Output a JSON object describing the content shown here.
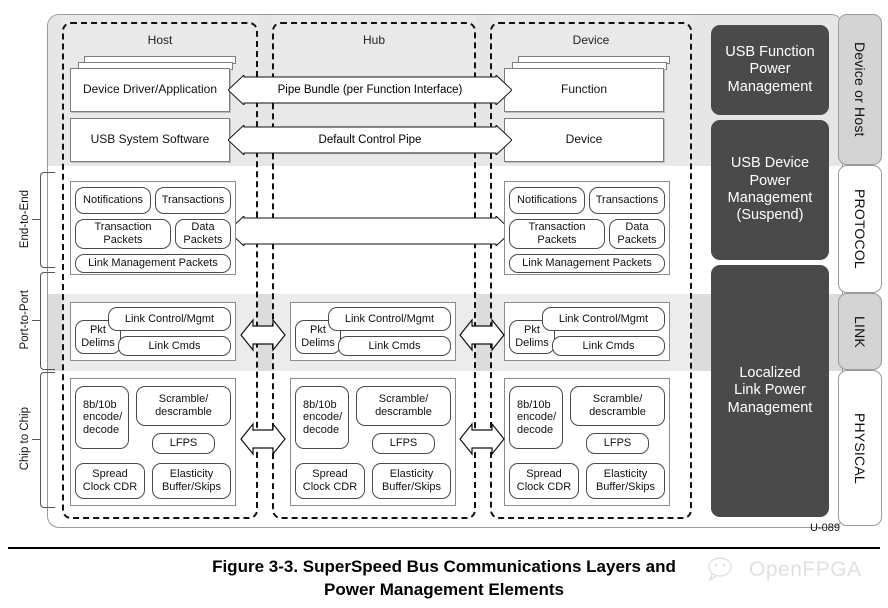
{
  "figure": {
    "caption_line1": "Figure 3-3.  SuperSpeed Bus Communications Layers and",
    "caption_line2": "Power Management Elements",
    "code": "U-089",
    "watermark": "OpenFPGA"
  },
  "columns": [
    {
      "id": "host",
      "title": "Host"
    },
    {
      "id": "hub",
      "title": "Hub"
    },
    {
      "id": "device",
      "title": "Device"
    }
  ],
  "layer_tabs": [
    {
      "id": "device-or-host",
      "label": "Device or Host",
      "fill": "#d4d4d4"
    },
    {
      "id": "protocol",
      "label": "PROTOCOL",
      "fill": "#ffffff"
    },
    {
      "id": "link",
      "label": "LINK",
      "fill": "#d4d4d4"
    },
    {
      "id": "physical",
      "label": "PHYSICAL",
      "fill": "#ffffff"
    }
  ],
  "scope_labels": [
    {
      "id": "end-to-end",
      "label": "End-to-End"
    },
    {
      "id": "port-to-port",
      "label": "Port-to-Port"
    },
    {
      "id": "chip-to-chip",
      "label": "Chip to Chip"
    }
  ],
  "host": {
    "device_driver": "Device Driver/Application",
    "usb_system_software": "USB System Software"
  },
  "device": {
    "function": "Function",
    "device": "Device"
  },
  "pipes": [
    {
      "id": "pipe-bundle",
      "label": "Pipe Bundle (per Function Interface)"
    },
    {
      "id": "default-control-pipe",
      "label": "Default Control Pipe"
    }
  ],
  "protocol_blocks": {
    "notifications": "Notifications",
    "transactions": "Transactions",
    "transaction_packets": "Transaction\nPackets",
    "transaction_packets_l1": "Transaction",
    "transaction_packets_l2": "Packets",
    "data_packets_l1": "Data",
    "data_packets_l2": "Packets",
    "link_management_packets": "Link Management Packets"
  },
  "link_blocks": {
    "pkt_delims_l1": "Pkt",
    "pkt_delims_l2": "Delims",
    "link_control_mgmt": "Link Control/Mgmt",
    "link_cmds": "Link Cmds"
  },
  "physical_blocks": {
    "encode_l1": "8b/10b",
    "encode_l2": "encode/",
    "encode_l3": "decode",
    "scramble_l1": "Scramble/",
    "scramble_l2": "descramble",
    "lfps": "LFPS",
    "spread_l1": "Spread",
    "spread_l2": "Clock CDR",
    "elasticity_l1": "Elasticity",
    "elasticity_l2": "Buffer/Skips"
  },
  "power_management": [
    {
      "id": "usb-function-power-management",
      "l1": "USB Function",
      "l2": "Power",
      "l3": "Management",
      "l4": ""
    },
    {
      "id": "usb-device-power-management",
      "l1": "USB Device",
      "l2": "Power",
      "l3": "Management",
      "l4": "(Suspend)"
    },
    {
      "id": "localized-link-power-management",
      "l1": "Localized",
      "l2": "Link Power",
      "l3": "Management",
      "l4": ""
    }
  ],
  "colors": {
    "pm_block": "#4a4a4a",
    "band_device_or_host": "#e6e6e6",
    "band_link": "#dcdcdc",
    "tab_gray": "#d4d4d4"
  }
}
